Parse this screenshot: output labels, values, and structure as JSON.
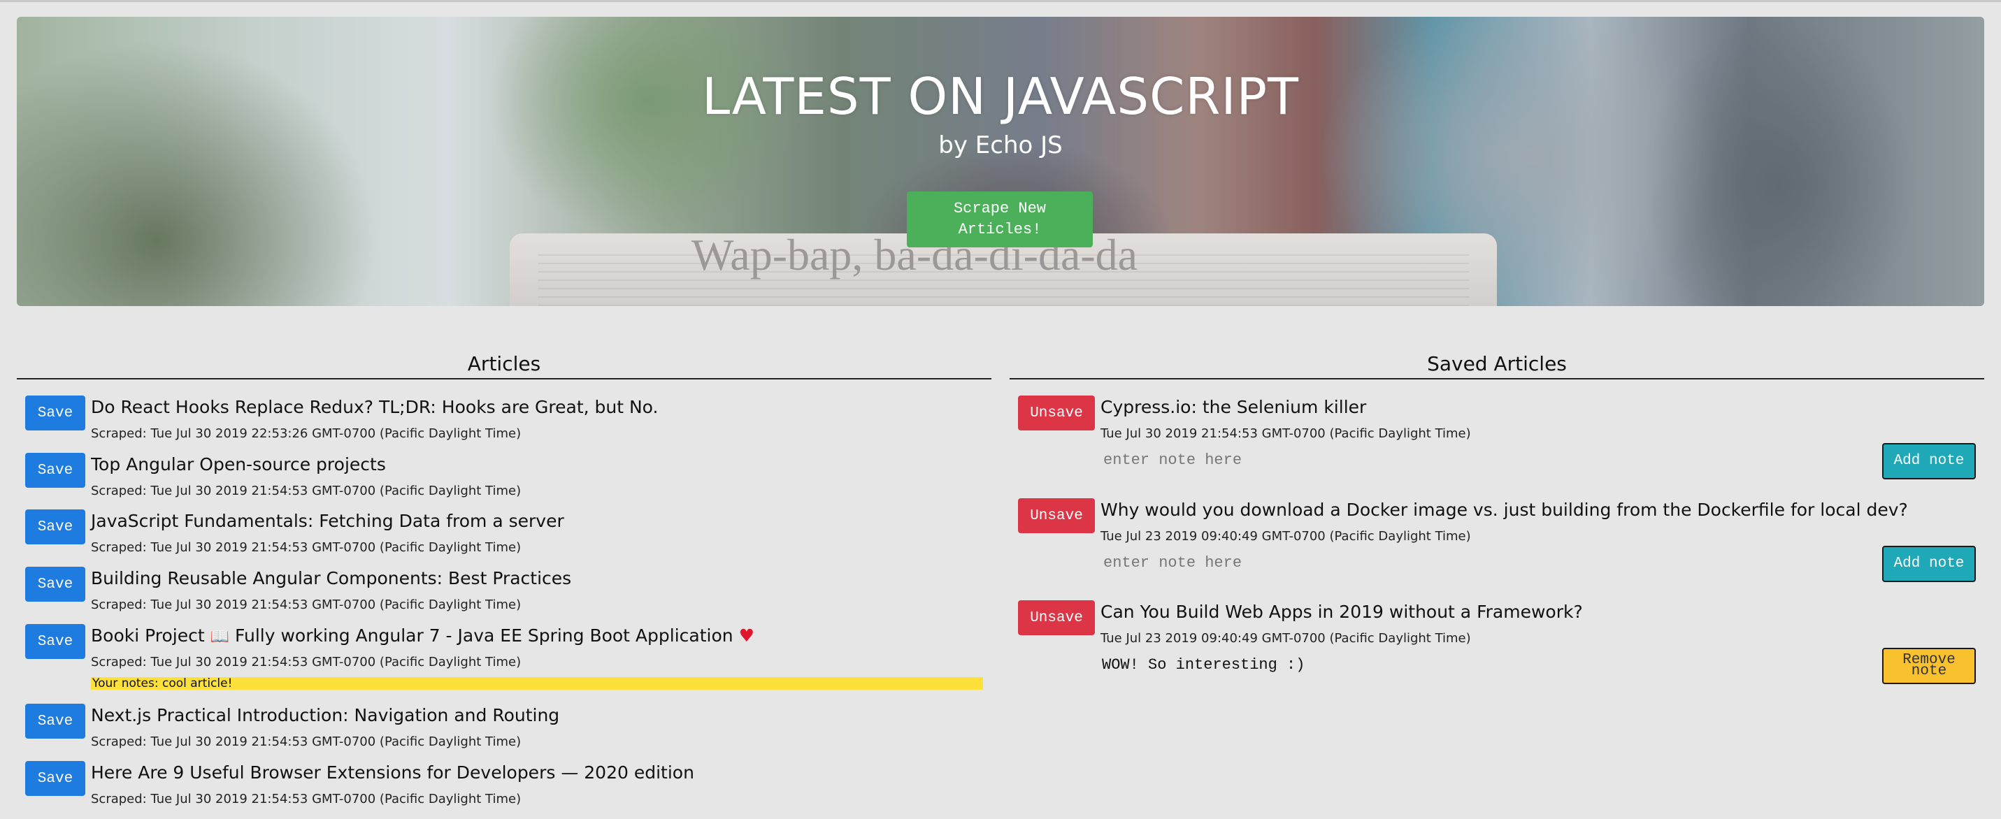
{
  "hero": {
    "title": "LATEST ON JAVASCRIPT",
    "subtitle": "by Echo JS",
    "scrape_button": "Scrape New Articles!",
    "image_headline": "Wap-bap, ba-da-di-da-da"
  },
  "articles": {
    "heading": "Articles",
    "save_label": "Save",
    "items": [
      {
        "title": "Do React Hooks Replace Redux? TL;DR: Hooks are Great, but No.",
        "scraped": "Scraped: Tue Jul 30 2019 22:53:26 GMT-0700 (Pacific Daylight Time)"
      },
      {
        "title": "Top Angular Open-source projects",
        "scraped": "Scraped: Tue Jul 30 2019 21:54:53 GMT-0700 (Pacific Daylight Time)"
      },
      {
        "title": "JavaScript Fundamentals: Fetching Data from a server",
        "scraped": "Scraped: Tue Jul 30 2019 21:54:53 GMT-0700 (Pacific Daylight Time)"
      },
      {
        "title": "Building Reusable Angular Components: Best Practices",
        "scraped": "Scraped: Tue Jul 30 2019 21:54:53 GMT-0700 (Pacific Daylight Time)"
      },
      {
        "title_pre": "Booki Project",
        "book_glyph": "📖",
        "title_post": " Fully working Angular 7 - Java EE Spring Boot Application",
        "heart_glyph": "♥",
        "scraped": "Scraped: Tue Jul 30 2019 21:54:53 GMT-0700 (Pacific Daylight Time)",
        "note": "Your notes: cool article!"
      },
      {
        "title": "Next.js Practical Introduction: Navigation and Routing",
        "scraped": "Scraped: Tue Jul 30 2019 21:54:53 GMT-0700 (Pacific Daylight Time)"
      },
      {
        "title": "Here Are 9 Useful Browser Extensions for Developers — 2020 edition",
        "scraped": "Scraped: Tue Jul 30 2019 21:54:53 GMT-0700 (Pacific Daylight Time)"
      }
    ]
  },
  "saved": {
    "heading": "Saved Articles",
    "unsave_label": "Unsave",
    "note_placeholder": "enter note here",
    "add_note_label": "Add note",
    "remove_note_label": "Remove note",
    "items": [
      {
        "title": "Cypress.io: the Selenium killer",
        "date": "Tue Jul 30 2019 21:54:53 GMT-0700 (Pacific Daylight Time)"
      },
      {
        "title": "Why would you download a Docker image vs. just building from the Dockerfile for local dev?",
        "date": "Tue Jul 23 2019 09:40:49 GMT-0700 (Pacific Daylight Time)"
      },
      {
        "title": "Can You Build Web Apps in 2019 without a Framework?",
        "date": "Tue Jul 23 2019 09:40:49 GMT-0700 (Pacific Daylight Time)",
        "note": "WOW! So interesting :)"
      }
    ]
  },
  "colors": {
    "save": "#1e7be0",
    "unsave": "#dc3545",
    "scrape": "#4caf5a",
    "add_note": "#1ea8b8",
    "remove_note": "#f9c12d",
    "note_highlight": "#fde13a"
  }
}
